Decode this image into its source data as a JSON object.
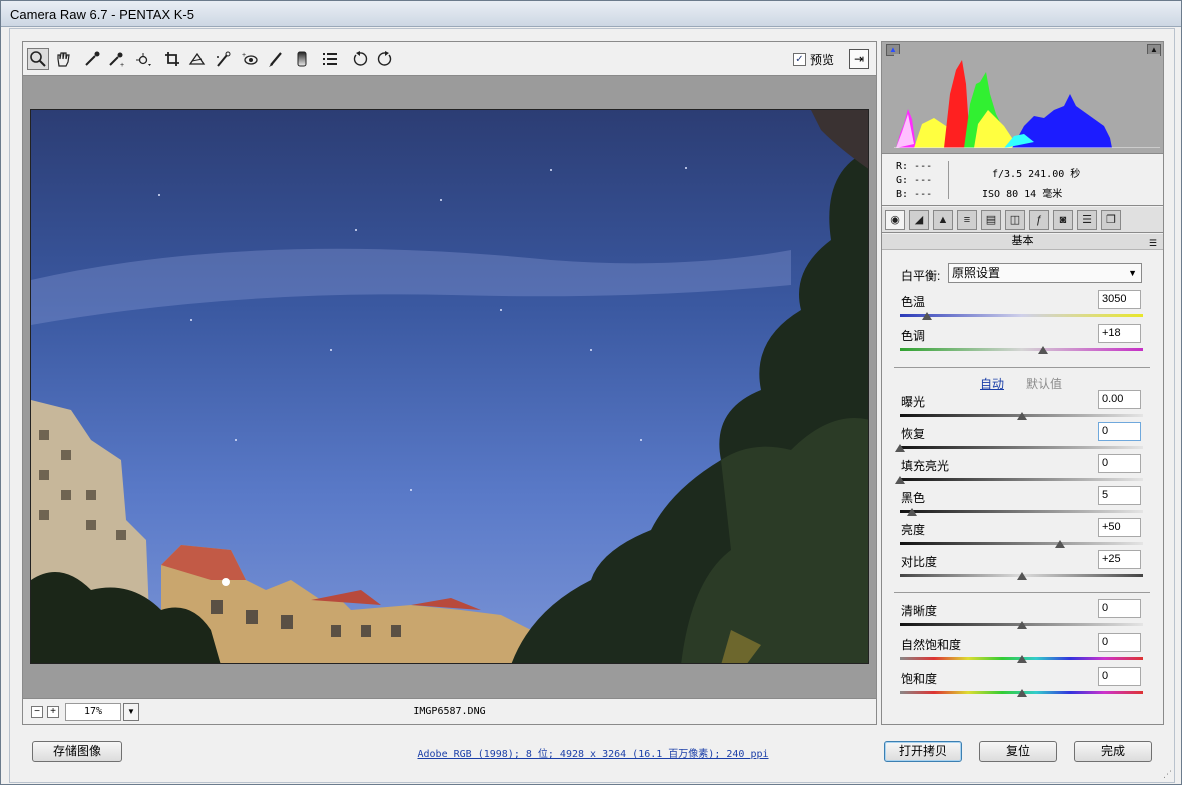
{
  "window": {
    "title": "Camera Raw 6.7 -  PENTAX K-5"
  },
  "toolbar": {
    "tools": [
      "zoom-icon",
      "hand-icon",
      "white-balance-icon",
      "color-sampler-icon",
      "target-adjust-icon",
      "crop-icon",
      "straighten-icon",
      "spot-removal-icon",
      "red-eye-icon",
      "adjustment-brush-icon",
      "graduated-filter-icon",
      "preferences-icon",
      "rotate-ccw-icon",
      "rotate-cw-icon"
    ],
    "preview_label": "预览",
    "preview_checked": true
  },
  "statusbar": {
    "zoom": "17%",
    "filename": "IMGP6587.DNG"
  },
  "readout": {
    "r": "R:  ---",
    "g": "G:  ---",
    "b": "B:  ---",
    "aperture_shutter": "f/3.5  241.00 秒",
    "iso_focal": "ISO 80  14 毫米"
  },
  "panel": {
    "title": "基本",
    "white_balance_label": "白平衡:",
    "white_balance_value": "原照设置",
    "auto": "自动",
    "default": "默认值",
    "sliders": [
      {
        "label": "色温",
        "value": "3050",
        "level": 0.11
      },
      {
        "label": "色调",
        "value": "+18",
        "level": 0.59
      },
      {
        "label": "曝光",
        "value": "0.00",
        "level": 0.5
      },
      {
        "label": "恢复",
        "value": "0",
        "level": 0.0
      },
      {
        "label": "填充亮光",
        "value": "0",
        "level": 0.0
      },
      {
        "label": "黑色",
        "value": "5",
        "level": 0.05
      },
      {
        "label": "亮度",
        "value": "+50",
        "level": 0.66
      },
      {
        "label": "对比度",
        "value": "+25",
        "level": 0.5
      },
      {
        "label": "清晰度",
        "value": "0",
        "level": 0.5
      },
      {
        "label": "自然饱和度",
        "value": "0",
        "level": 0.5
      },
      {
        "label": "饱和度",
        "value": "0",
        "level": 0.5
      }
    ]
  },
  "bottom": {
    "save_label": "存储图像",
    "info_link": "Adobe RGB (1998); 8 位;  4928 x 3264 (16.1 百万像素); 240 ppi",
    "open_copy_label": "打开拷贝",
    "reset_label": "复位",
    "done_label": "完成"
  }
}
